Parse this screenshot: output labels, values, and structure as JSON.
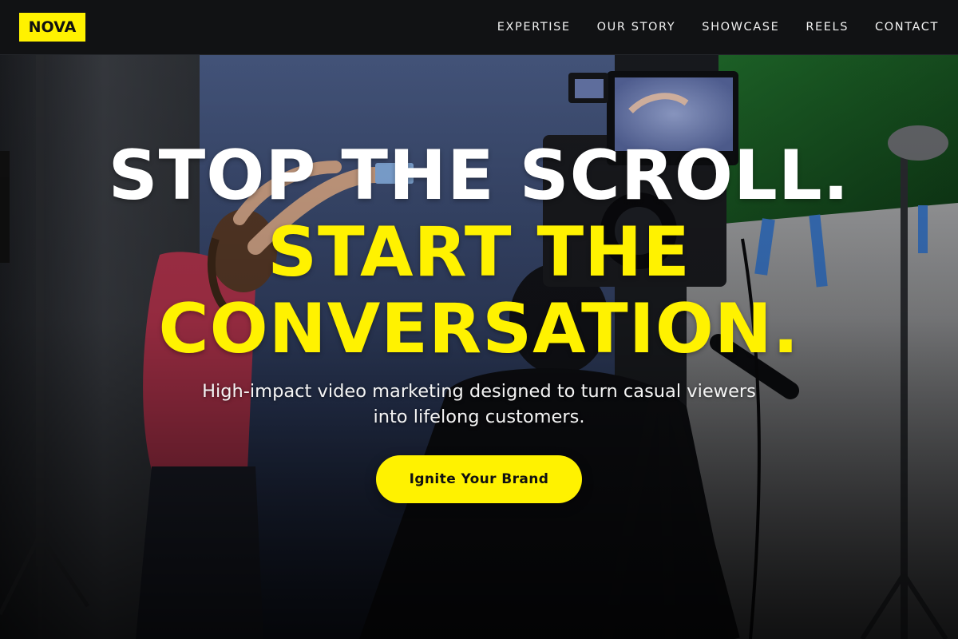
{
  "header": {
    "logo": "NOVA",
    "nav": [
      {
        "label": "EXPERTISE"
      },
      {
        "label": "OUR STORY"
      },
      {
        "label": "SHOWCASE"
      },
      {
        "label": "REELS"
      },
      {
        "label": "CONTACT"
      }
    ]
  },
  "hero": {
    "headline_line1": "STOP THE SCROLL.",
    "headline_line2": "START THE",
    "headline_line3": "CONVERSATION.",
    "subhead": "High-impact video marketing designed to turn casual viewers into lifelong customers.",
    "cta_label": "Ignite Your Brand",
    "background_image": "video-studio-shoot-photo"
  },
  "colors": {
    "accent_yellow": "#fff200",
    "header_bg": "#111214",
    "text_white": "#ffffff"
  }
}
